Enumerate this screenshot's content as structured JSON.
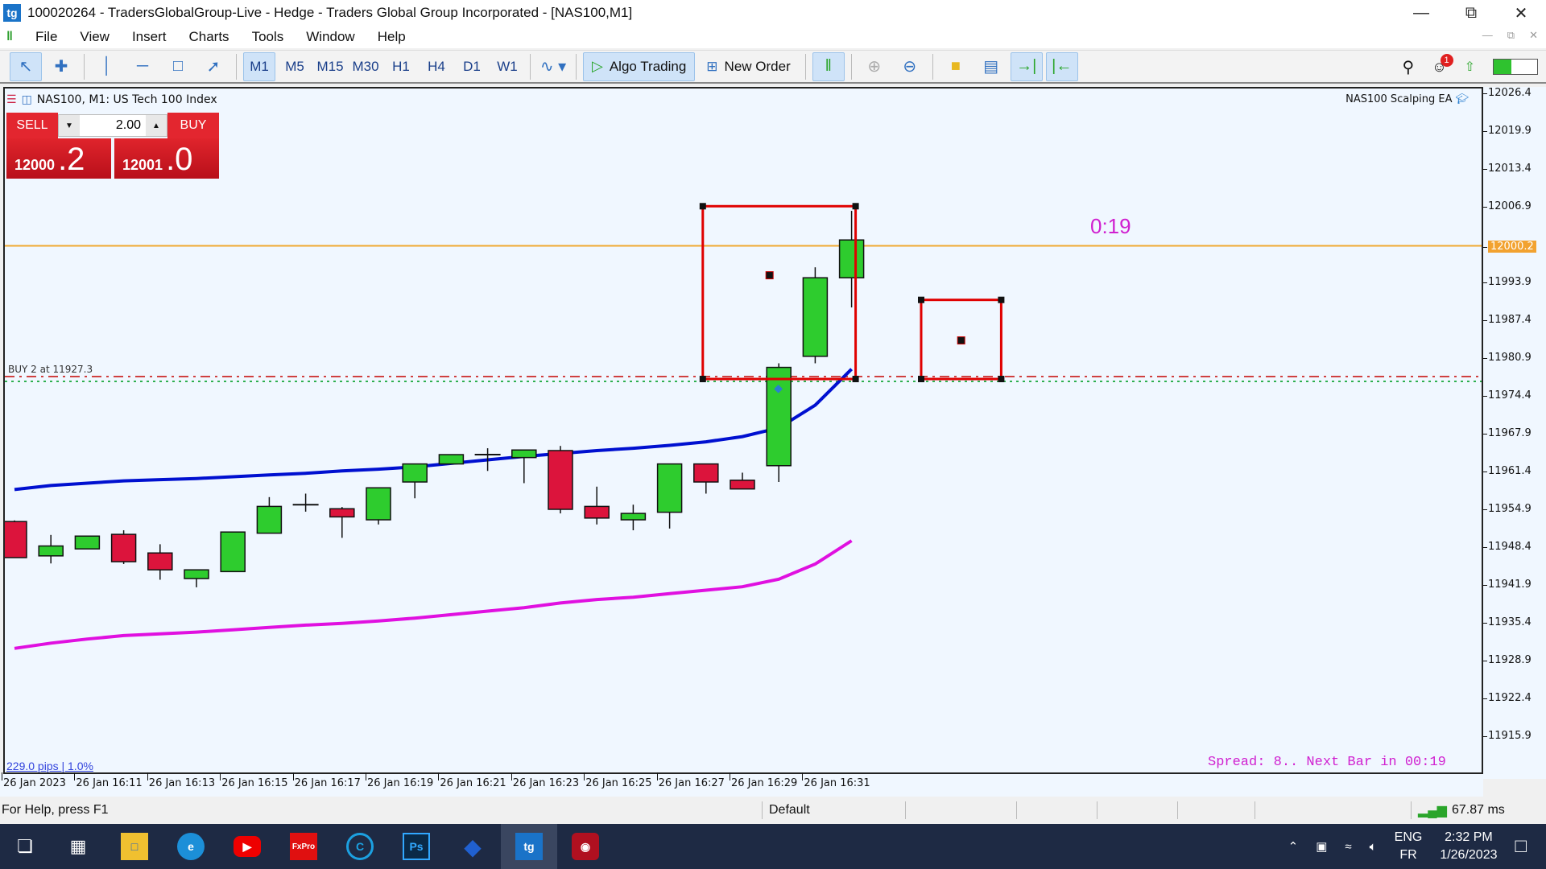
{
  "window": {
    "title": "100020264 - TradersGlobalGroup-Live - Hedge - Traders Global Group Incorporated - [NAS100,M1]",
    "logo": "tg"
  },
  "menu": [
    "File",
    "View",
    "Insert",
    "Charts",
    "Tools",
    "Window",
    "Help"
  ],
  "toolbar": {
    "timeframes": [
      "M1",
      "M5",
      "M15",
      "M30",
      "H1",
      "H4",
      "D1",
      "W1"
    ],
    "active_timeframe": "M1",
    "algo_trading": "Algo Trading",
    "new_order": "New Order",
    "notification_count": "1"
  },
  "chart": {
    "symbol_title": "NAS100, M1:  US Tech 100 Index",
    "ea_name": "NAS100 Scalping EA",
    "sell_label": "SELL",
    "buy_label": "BUY",
    "lot": "2.00",
    "sell_price_main": "12000",
    "sell_price_frac": ".2",
    "buy_price_main": "12001",
    "buy_price_frac": ".0",
    "order_label": "BUY 2 at 11927.3",
    "timer": "0:19",
    "pips": "229.0 pips | 1.0%",
    "spread_text": "Spread: 8.. Next Bar in 00:19",
    "current_price": "12000.2",
    "colors": {
      "bull": "#2ecc2e",
      "bear": "#dc143c",
      "ma_upper": "#0010d0",
      "ma_lower": "#e010e0",
      "bid_line": "#f0a830",
      "box": "#e00000"
    }
  },
  "chart_data": {
    "type": "candlestick",
    "symbol": "NAS100",
    "timeframe": "M1",
    "y_ticks": [
      "12026.4",
      "12019.9",
      "12013.4",
      "12006.9",
      "12000.2",
      "11993.9",
      "11987.4",
      "11980.9",
      "11974.4",
      "11967.9",
      "11961.4",
      "11954.9",
      "11948.4",
      "11941.9",
      "11935.4",
      "11928.9",
      "11922.4",
      "11915.9"
    ],
    "ylim": [
      11910.0,
      12028.0
    ],
    "x_ticks": [
      "26 Jan 2023",
      "26 Jan 16:11",
      "26 Jan 16:13",
      "26 Jan 16:15",
      "26 Jan 16:17",
      "26 Jan 16:19",
      "26 Jan 16:21",
      "26 Jan 16:23",
      "26 Jan 16:25",
      "26 Jan 16:27",
      "26 Jan 16:29",
      "26 Jan 16:31"
    ],
    "candles": [
      {
        "o": 11952.8,
        "h": 11953.0,
        "l": 11946.6,
        "c": 11946.6
      },
      {
        "o": 11946.9,
        "h": 11950.5,
        "l": 11945.6,
        "c": 11948.6
      },
      {
        "o": 11948.1,
        "h": 11950.3,
        "l": 11948.1,
        "c": 11950.3
      },
      {
        "o": 11950.6,
        "h": 11951.3,
        "l": 11945.5,
        "c": 11945.9
      },
      {
        "o": 11947.4,
        "h": 11948.9,
        "l": 11942.8,
        "c": 11944.5
      },
      {
        "o": 11943.0,
        "h": 11944.5,
        "l": 11941.5,
        "c": 11944.5
      },
      {
        "o": 11944.2,
        "h": 11944.2,
        "l": 11944.2,
        "c": 11951.0
      },
      {
        "o": 11950.8,
        "h": 11957.0,
        "l": 11950.8,
        "c": 11955.4
      },
      {
        "o": 11955.7,
        "h": 11957.6,
        "l": 11954.5,
        "c": 11955.7
      },
      {
        "o": 11955.0,
        "h": 11955.3,
        "l": 11950.0,
        "c": 11953.6
      },
      {
        "o": 11953.1,
        "h": 11958.4,
        "l": 11952.3,
        "c": 11958.6
      },
      {
        "o": 11959.6,
        "h": 11962.7,
        "l": 11956.8,
        "c": 11962.7
      },
      {
        "o": 11962.7,
        "h": 11963.3,
        "l": 11962.7,
        "c": 11964.3
      },
      {
        "o": 11963.9,
        "h": 11965.4,
        "l": 11961.5,
        "c": 11964.3
      },
      {
        "o": 11963.8,
        "h": 11965.1,
        "l": 11959.4,
        "c": 11965.1
      },
      {
        "o": 11965.0,
        "h": 11965.8,
        "l": 11954.2,
        "c": 11954.9
      },
      {
        "o": 11955.4,
        "h": 11958.8,
        "l": 11952.3,
        "c": 11953.4
      },
      {
        "o": 11953.1,
        "h": 11955.7,
        "l": 11951.3,
        "c": 11954.2
      },
      {
        "o": 11954.4,
        "h": 11962.7,
        "l": 11951.6,
        "c": 11962.7
      },
      {
        "o": 11962.7,
        "h": 11962.7,
        "l": 11957.6,
        "c": 11959.6
      },
      {
        "o": 11959.9,
        "h": 11961.2,
        "l": 11958.4,
        "c": 11958.4
      },
      {
        "o": 11962.4,
        "h": 11980.0,
        "l": 11959.6,
        "c": 11979.3
      },
      {
        "o": 11981.2,
        "h": 11996.5,
        "l": 11980.0,
        "c": 11994.7
      },
      {
        "o": 11994.7,
        "h": 12006.2,
        "l": 11989.6,
        "c": 12001.2
      }
    ],
    "ma_upper": [
      11958.3,
      11959.0,
      11959.4,
      11959.8,
      11960.0,
      11960.2,
      11960.5,
      11960.8,
      11961.1,
      11961.5,
      11961.8,
      11962.2,
      11962.8,
      11963.4,
      11964.0,
      11964.5,
      11965.0,
      11965.4,
      11965.9,
      11966.5,
      11967.4,
      11968.9,
      11972.8,
      11979.0
    ],
    "ma_lower": [
      11931.0,
      11931.9,
      11932.6,
      11933.2,
      11933.5,
      11933.8,
      11934.2,
      11934.6,
      11935.0,
      11935.3,
      11935.7,
      11936.2,
      11936.8,
      11937.4,
      11938.0,
      11938.8,
      11939.4,
      11939.8,
      11940.4,
      11941.0,
      11941.6,
      11942.9,
      11945.5,
      11949.5
    ],
    "bid_line": 12000.2,
    "order_line": 11977.3,
    "boxes": [
      {
        "from_bar": 19,
        "to_bar": 23,
        "top": 12007.0,
        "bottom": 11977.3,
        "mid_price": 11995.2,
        "mid_bar": 21
      },
      {
        "from_bar": 25,
        "to_bar": 27,
        "top": 11990.9,
        "bottom": 11977.3,
        "mid_price": 11984.0,
        "mid_bar": 26
      }
    ]
  },
  "statusbar": {
    "help": "For Help, press F1",
    "profile": "Default",
    "ping": "67.87 ms"
  },
  "taskbar": {
    "apps": [
      "Start",
      "Task View",
      "File Explorer",
      "Edge",
      "YouTube",
      "FxPro",
      "CCleaner",
      "Photoshop",
      "Pip",
      "Traders Global",
      "Recorder"
    ],
    "lang_top": "ENG",
    "lang_bottom": "FR",
    "time": "2:32 PM",
    "date": "1/26/2023"
  }
}
